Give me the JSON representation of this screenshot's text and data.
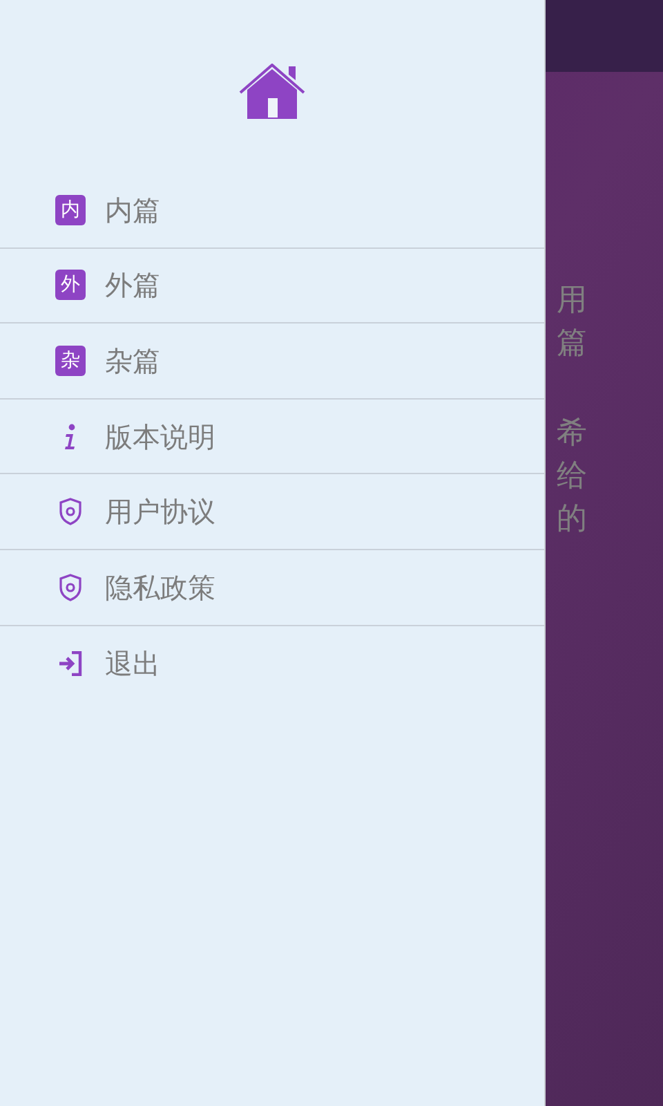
{
  "background_text": [
    "用",
    "篇",
    "希",
    "给",
    "的"
  ],
  "menu": [
    {
      "kind": "badge",
      "badge": "内",
      "label": "内篇"
    },
    {
      "kind": "badge",
      "badge": "外",
      "label": "外篇"
    },
    {
      "kind": "badge",
      "badge": "杂",
      "label": "杂篇"
    },
    {
      "kind": "info",
      "label": "版本说明"
    },
    {
      "kind": "shield",
      "label": "用户协议"
    },
    {
      "kind": "shield",
      "label": "隐私政策"
    },
    {
      "kind": "exit",
      "label": "退出"
    }
  ]
}
